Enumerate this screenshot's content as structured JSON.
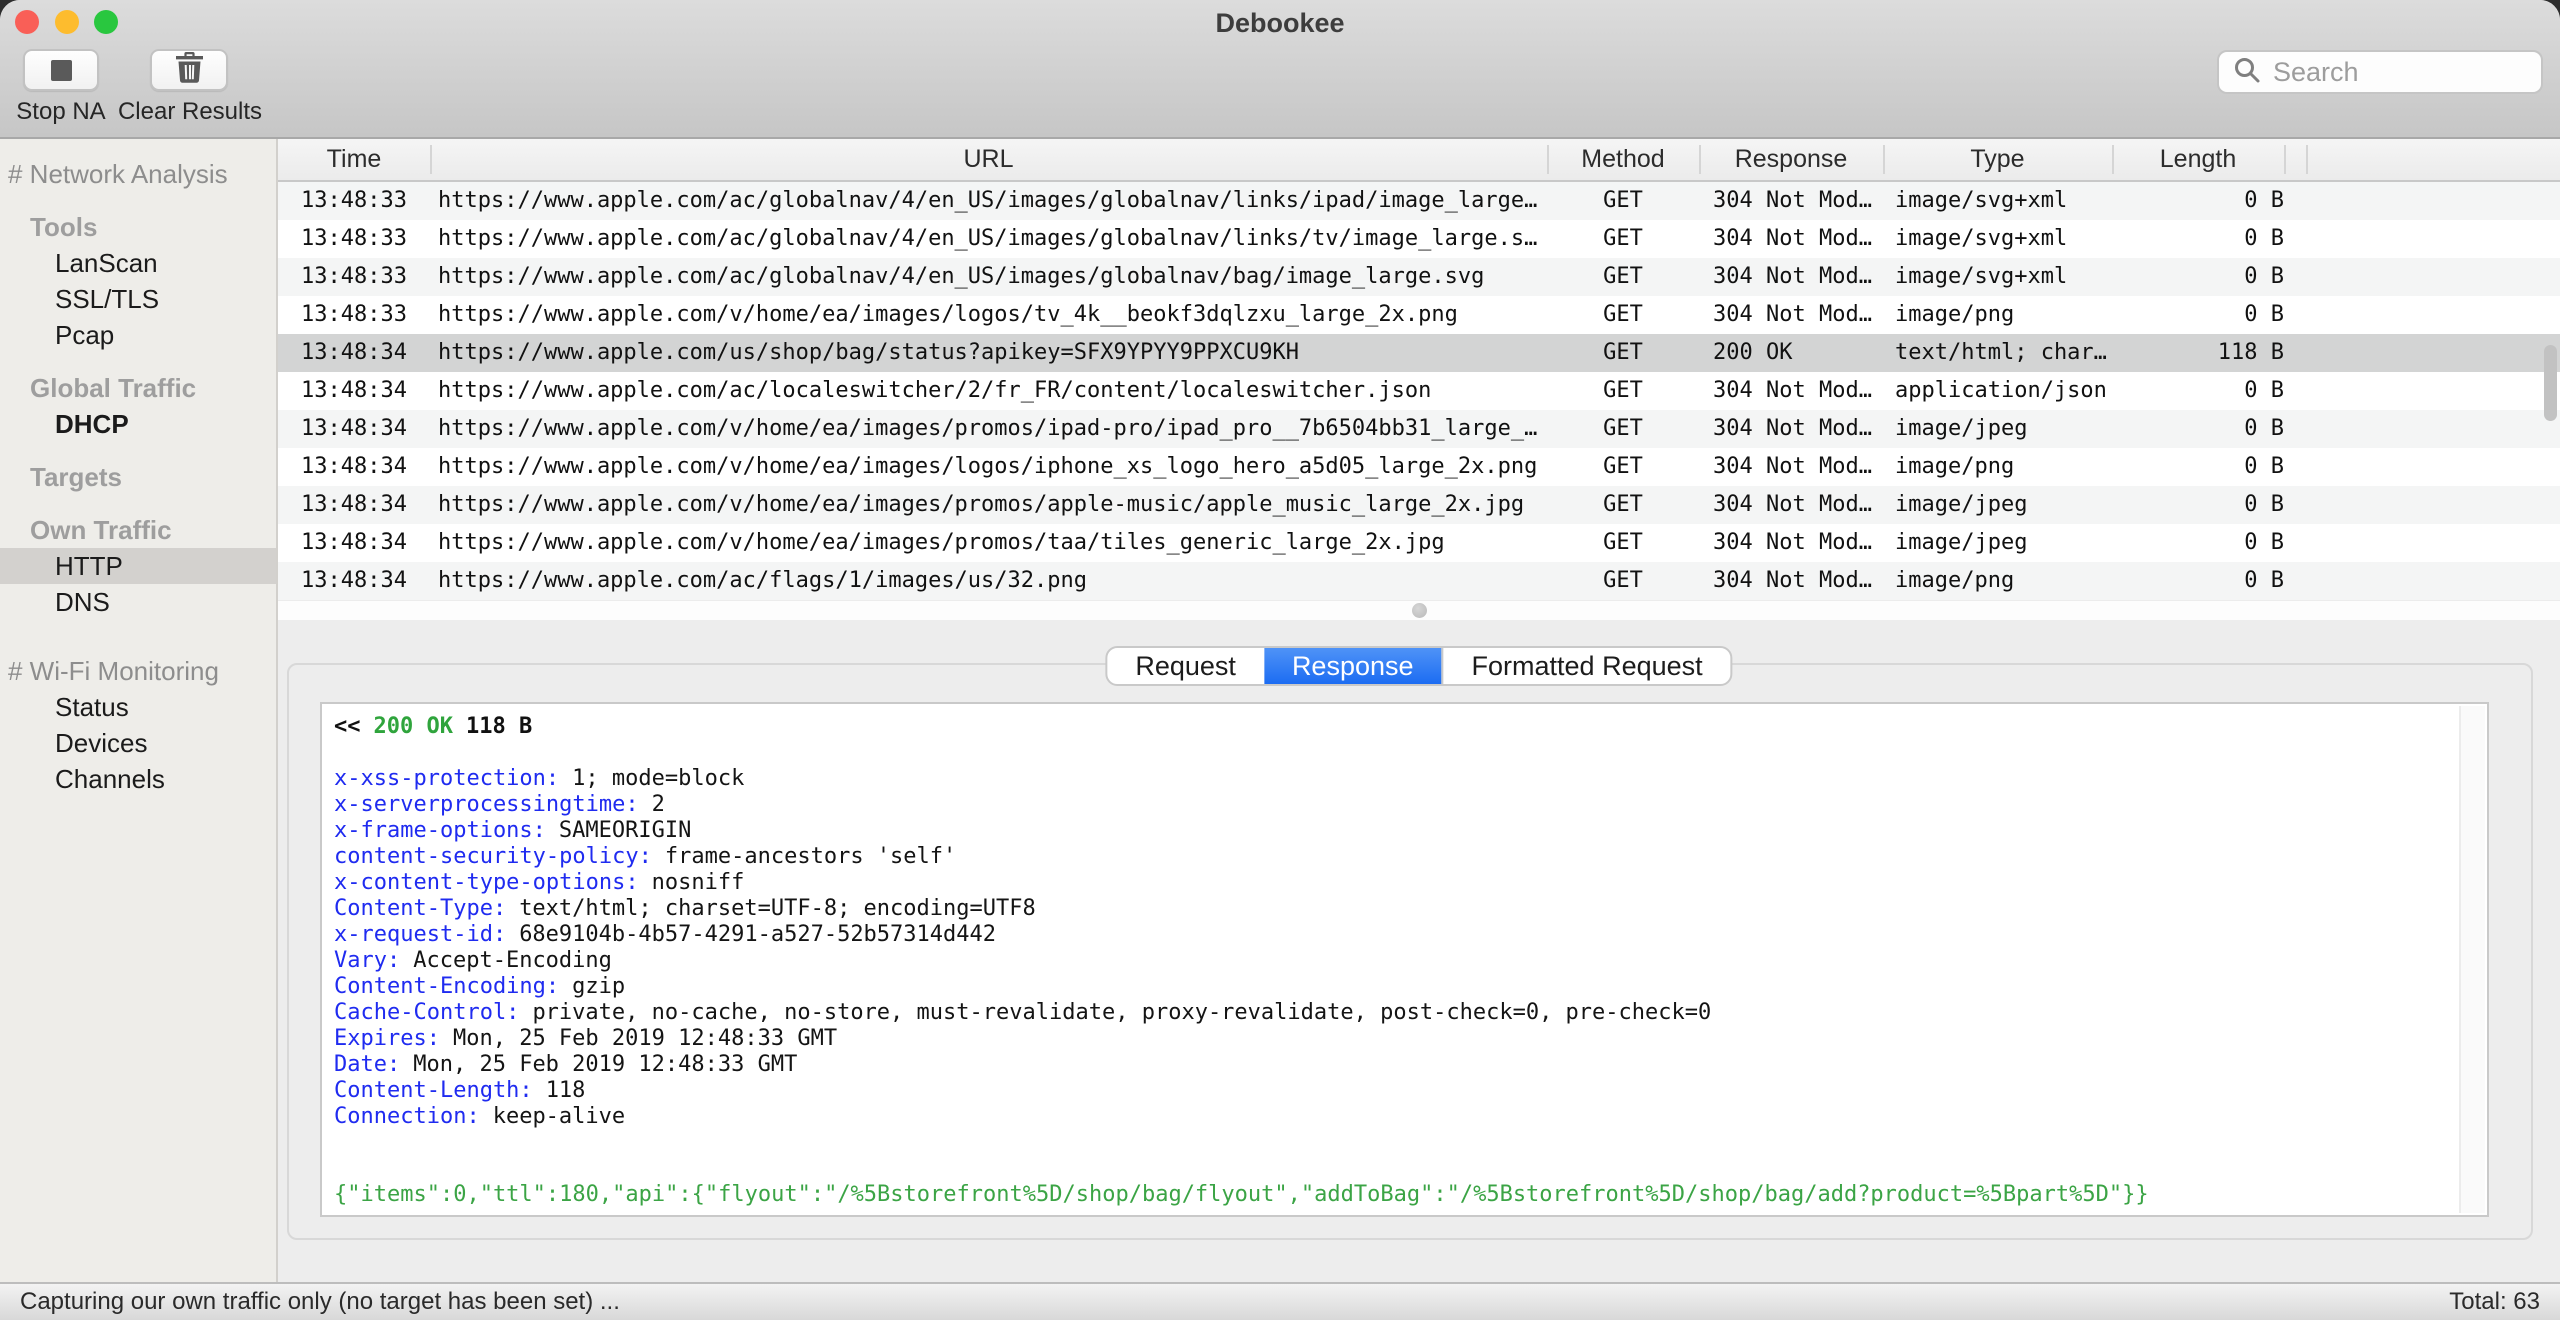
{
  "window": {
    "title": "Debookee"
  },
  "toolbar": {
    "stop_label": "Stop NA",
    "clear_label": "Clear Results",
    "search_placeholder": "Search"
  },
  "sidebar": {
    "sections": [
      {
        "header": "# Network Analysis",
        "groups": [
          {
            "label": "Tools",
            "items": [
              {
                "label": "LanScan"
              },
              {
                "label": "SSL/TLS"
              },
              {
                "label": "Pcap"
              }
            ]
          },
          {
            "label": "Global Traffic",
            "items": [
              {
                "label": "DHCP",
                "bold": true
              }
            ]
          },
          {
            "label": "Targets",
            "items": []
          },
          {
            "label": "Own Traffic",
            "items": [
              {
                "label": "HTTP",
                "selected": true
              },
              {
                "label": "DNS"
              }
            ]
          }
        ]
      },
      {
        "header": "# Wi-Fi Monitoring",
        "groups": [
          {
            "label": "",
            "items": [
              {
                "label": "Status"
              },
              {
                "label": "Devices"
              },
              {
                "label": "Channels"
              }
            ]
          }
        ]
      }
    ]
  },
  "table": {
    "columns": [
      "Time",
      "URL",
      "Method",
      "Response",
      "Type",
      "Length"
    ],
    "rows": [
      {
        "time": "13:48:33",
        "url": "https://www.apple.com/ac/globalnav/4/en_US/images/globalnav/links/ipad/image_large…",
        "method": "GET",
        "response": "304 Not Mod…",
        "type": "image/svg+xml",
        "length": "0 B",
        "selected": false
      },
      {
        "time": "13:48:33",
        "url": "https://www.apple.com/ac/globalnav/4/en_US/images/globalnav/links/tv/image_large.s…",
        "method": "GET",
        "response": "304 Not Mod…",
        "type": "image/svg+xml",
        "length": "0 B",
        "selected": false
      },
      {
        "time": "13:48:33",
        "url": "https://www.apple.com/ac/globalnav/4/en_US/images/globalnav/bag/image_large.svg",
        "method": "GET",
        "response": "304 Not Mod…",
        "type": "image/svg+xml",
        "length": "0 B",
        "selected": false
      },
      {
        "time": "13:48:33",
        "url": "https://www.apple.com/v/home/ea/images/logos/tv_4k__beokf3dqlzxu_large_2x.png",
        "method": "GET",
        "response": "304 Not Mod…",
        "type": "image/png",
        "length": "0 B",
        "selected": false
      },
      {
        "time": "13:48:34",
        "url": "https://www.apple.com/us/shop/bag/status?apikey=SFX9YPYY9PPXCU9KH",
        "method": "GET",
        "response": "200 OK",
        "type": "text/html; char…",
        "length": "118 B",
        "selected": true
      },
      {
        "time": "13:48:34",
        "url": "https://www.apple.com/ac/localeswitcher/2/fr_FR/content/localeswitcher.json",
        "method": "GET",
        "response": "304 Not Mod…",
        "type": "application/json",
        "length": "0 B",
        "selected": false
      },
      {
        "time": "13:48:34",
        "url": "https://www.apple.com/v/home/ea/images/promos/ipad-pro/ipad_pro__7b6504bb31_large_…",
        "method": "GET",
        "response": "304 Not Mod…",
        "type": "image/jpeg",
        "length": "0 B",
        "selected": false
      },
      {
        "time": "13:48:34",
        "url": "https://www.apple.com/v/home/ea/images/logos/iphone_xs_logo_hero_a5d05_large_2x.png",
        "method": "GET",
        "response": "304 Not Mod…",
        "type": "image/png",
        "length": "0 B",
        "selected": false
      },
      {
        "time": "13:48:34",
        "url": "https://www.apple.com/v/home/ea/images/promos/apple-music/apple_music_large_2x.jpg",
        "method": "GET",
        "response": "304 Not Mod…",
        "type": "image/jpeg",
        "length": "0 B",
        "selected": false
      },
      {
        "time": "13:48:34",
        "url": "https://www.apple.com/v/home/ea/images/promos/taa/tiles_generic_large_2x.jpg",
        "method": "GET",
        "response": "304 Not Mod…",
        "type": "image/jpeg",
        "length": "0 B",
        "selected": false
      },
      {
        "time": "13:48:34",
        "url": "https://www.apple.com/ac/flags/1/images/us/32.png",
        "method": "GET",
        "response": "304 Not Mod…",
        "type": "image/png",
        "length": "0 B",
        "selected": false
      }
    ]
  },
  "detail": {
    "tabs": [
      "Request",
      "Response",
      "Formatted Request"
    ],
    "active_tab": "Response",
    "status_line": {
      "prefix": "<<",
      "status": "200 OK",
      "size": "118 B"
    },
    "headers": [
      {
        "key": "x-xss-protection:",
        "value": "1; mode=block"
      },
      {
        "key": "x-serverprocessingtime:",
        "value": "2"
      },
      {
        "key": "x-frame-options:",
        "value": "SAMEORIGIN"
      },
      {
        "key": "content-security-policy:",
        "value": "frame-ancestors 'self'"
      },
      {
        "key": "x-content-type-options:",
        "value": "nosniff"
      },
      {
        "key": "Content-Type:",
        "value": "text/html; charset=UTF-8; encoding=UTF8"
      },
      {
        "key": "x-request-id:",
        "value": "68e9104b-4b57-4291-a527-52b57314d442"
      },
      {
        "key": "Vary:",
        "value": "Accept-Encoding"
      },
      {
        "key": "Content-Encoding:",
        "value": "gzip"
      },
      {
        "key": "Cache-Control:",
        "value": "private, no-cache, no-store, must-revalidate, proxy-revalidate, post-check=0, pre-check=0"
      },
      {
        "key": "Expires:",
        "value": "Mon, 25 Feb 2019 12:48:33 GMT"
      },
      {
        "key": "Date:",
        "value": "Mon, 25 Feb 2019 12:48:33 GMT"
      },
      {
        "key": "Content-Length:",
        "value": "118"
      },
      {
        "key": "Connection:",
        "value": "keep-alive"
      }
    ],
    "body": "{\"items\":0,\"ttl\":180,\"api\":{\"flyout\":\"/%5Bstorefront%5D/shop/bag/flyout\",\"addToBag\":\"/%5Bstorefront%5D/shop/bag/add?product=%5Bpart%5D\"}}"
  },
  "status_bar": {
    "left": "Capturing our own traffic only (no target has been set) ...",
    "right": "Total: 63"
  },
  "colors": {
    "accent_blue": "#2574f0",
    "header_key_blue": "#1f2bf0",
    "success_green": "#2fa43c",
    "body_green": "#3ba445",
    "selected_row_gray": "#d3d4d4",
    "sidebar_bg": "#eeede9"
  }
}
